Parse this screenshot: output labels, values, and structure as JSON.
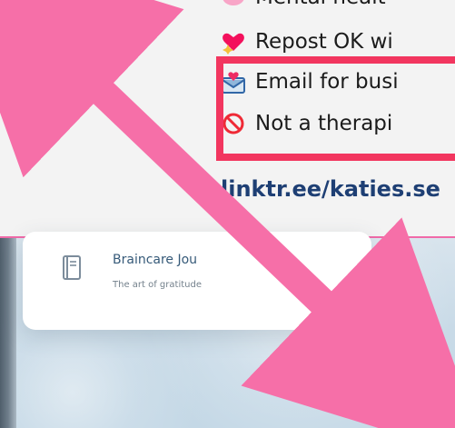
{
  "bio": {
    "lines": [
      {
        "text": "Mental healt",
        "icon": "brain-emoji-icon"
      },
      {
        "text": "Repost OK wi",
        "icon": "sparkling-heart-icon"
      },
      {
        "text": "Email for busi",
        "icon": "love-letter-icon"
      },
      {
        "text": "Not a therapi",
        "icon": "prohibited-icon"
      }
    ],
    "link": "linktr.ee/katies.se"
  },
  "card": {
    "title": "Braincare Jou",
    "subtitle": "The art of gratitude",
    "icon": "journal-icon"
  },
  "annotations": {
    "highlight_color": "#f2365f",
    "arrow_color": "#f66fa8"
  }
}
